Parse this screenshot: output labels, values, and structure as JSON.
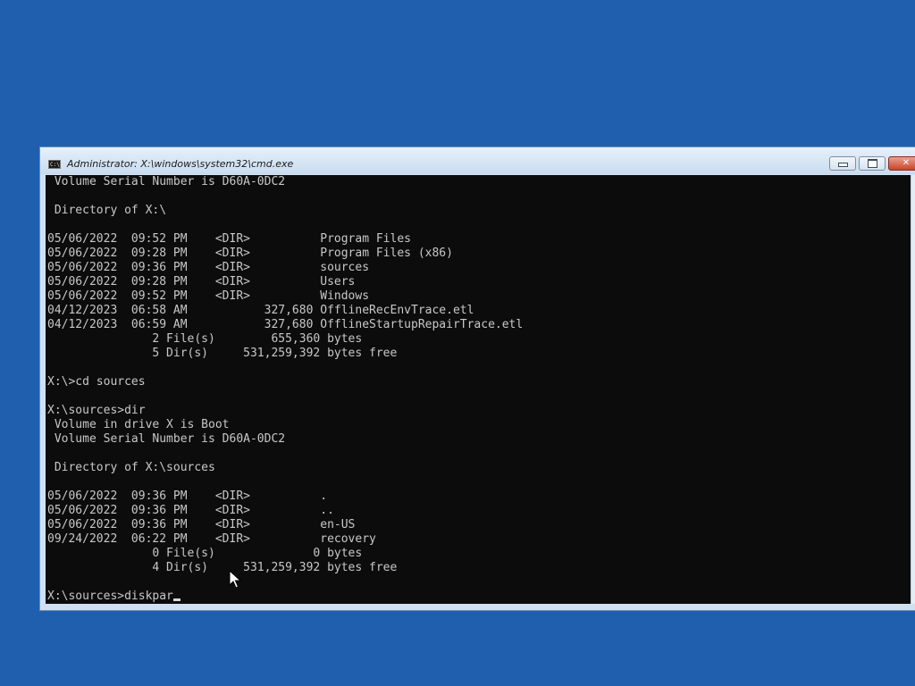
{
  "window": {
    "title": "Administrator: X:\\windows\\system32\\cmd.exe",
    "icon": "cmd-icon",
    "icon_text": "C:\\",
    "buttons": [
      "minimize-icon",
      "maximize-icon",
      "close-icon"
    ],
    "close_glyph": "✕"
  },
  "console": {
    "lines": [
      " Volume Serial Number is D60A-0DC2",
      "",
      " Directory of X:\\",
      "",
      "05/06/2022  09:52 PM    <DIR>          Program Files",
      "05/06/2022  09:28 PM    <DIR>          Program Files (x86)",
      "05/06/2022  09:36 PM    <DIR>          sources",
      "05/06/2022  09:28 PM    <DIR>          Users",
      "05/06/2022  09:52 PM    <DIR>          Windows",
      "04/12/2023  06:58 AM           327,680 OfflineRecEnvTrace.etl",
      "04/12/2023  06:59 AM           327,680 OfflineStartupRepairTrace.etl",
      "               2 File(s)        655,360 bytes",
      "               5 Dir(s)     531,259,392 bytes free",
      "",
      "X:\\>cd sources",
      "",
      "X:\\sources>dir",
      " Volume in drive X is Boot",
      " Volume Serial Number is D60A-0DC2",
      "",
      " Directory of X:\\sources",
      "",
      "05/06/2022  09:36 PM    <DIR>          .",
      "05/06/2022  09:36 PM    <DIR>          ..",
      "05/06/2022  09:36 PM    <DIR>          en-US",
      "09/24/2022  06:22 PM    <DIR>          recovery",
      "               0 File(s)              0 bytes",
      "               4 Dir(s)     531,259,392 bytes free",
      ""
    ],
    "input_line": "X:\\sources>diskpar"
  },
  "colors": {
    "desktop": "#1f5fae",
    "console_bg": "#0c0c0c",
    "console_text": "#c8c8c8"
  }
}
